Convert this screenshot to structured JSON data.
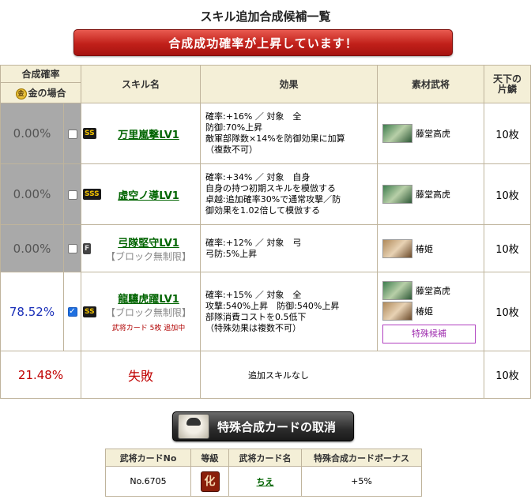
{
  "page_title": "スキル追加合成候補一覧",
  "banner": "合成成功確率が上昇しています！",
  "headers": {
    "rate_top": "合成確率",
    "rate_bottom": "金の場合",
    "coin": "金",
    "skill_name": "スキル名",
    "effect": "効果",
    "material": "素材武将",
    "count": "天下の片鱗"
  },
  "rows": [
    {
      "rate": "0.00%",
      "checked": false,
      "badge": "SS",
      "skill": "万里嵐撃LV1",
      "sub": "",
      "note": "",
      "effect": [
        "確率:+16% ／ 対象　全",
        "防御:70%上昇",
        "敵軍部隊数×14%を防御効果に加算",
        "（複数不可）"
      ],
      "materials": [
        {
          "name": "藤堂高虎",
          "portrait": "green"
        }
      ],
      "special": "",
      "count": "10枚"
    },
    {
      "rate": "0.00%",
      "checked": false,
      "badge": "SSS",
      "skill": "虚空ノ導LV1",
      "sub": "",
      "note": "",
      "effect": [
        "確率:+34% ／ 対象　自身",
        "自身の持つ初期スキルを模倣する",
        "卓越:追加確率30%で通常攻撃／防",
        "御効果を1.02倍して模倣する"
      ],
      "materials": [
        {
          "name": "藤堂高虎",
          "portrait": "green"
        }
      ],
      "special": "",
      "count": "10枚"
    },
    {
      "rate": "0.00%",
      "checked": false,
      "badge": "F",
      "skill": "弓隊堅守LV1",
      "sub": "【ブロック無制限】",
      "note": "",
      "effect": [
        "確率:+12% ／ 対象　弓",
        "弓防:5%上昇"
      ],
      "materials": [
        {
          "name": "椿姫",
          "portrait": "brown"
        }
      ],
      "special": "",
      "count": "10枚"
    },
    {
      "rate": "78.52%",
      "checked": true,
      "badge": "SS",
      "skill": "龍驤虎躍LV1",
      "sub": "【ブロック無制限】",
      "note": "武将カード 5枚 追加中",
      "effect": [
        "確率:+15% ／ 対象　全",
        "攻撃:540%上昇　防御:540%上昇",
        "部隊消費コストを0.5低下",
        "（特殊効果は複数不可）"
      ],
      "materials": [
        {
          "name": "藤堂高虎",
          "portrait": "green"
        },
        {
          "name": "椿姫",
          "portrait": "brown"
        }
      ],
      "special": "特殊候補",
      "count": "10枚"
    }
  ],
  "fail_row": {
    "rate": "21.48%",
    "label": "失敗",
    "effect": "追加スキルなし",
    "count": "10枚"
  },
  "cancel_button": "特殊合成カードの取消",
  "card_table": {
    "headers": [
      "武将カードNo",
      "等級",
      "武将カード名",
      "特殊合成カードボーナス"
    ],
    "row": {
      "no": "No.6705",
      "grade": "化",
      "name": "ちえ",
      "bonus": "+5%"
    }
  },
  "colors": {
    "banner": "#c1201a",
    "skill_link": "#006400",
    "rate_blue": "#1a2fb8",
    "rate_red": "#c00000"
  }
}
